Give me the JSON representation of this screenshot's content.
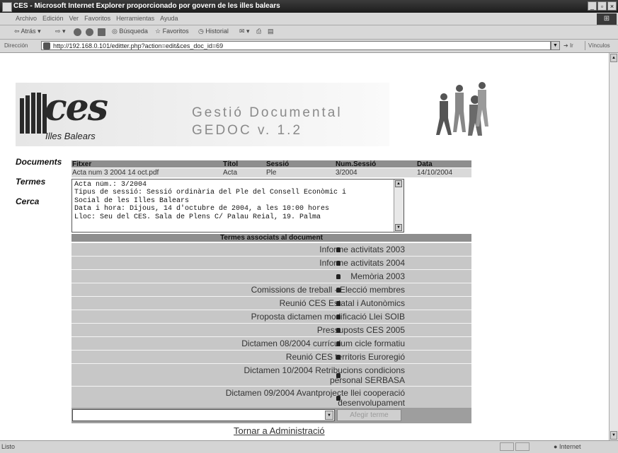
{
  "window": {
    "title": "CES - Microsoft Internet Explorer proporcionado por govern de les illes balears",
    "buttons": [
      "_",
      "▫",
      "×"
    ]
  },
  "menubar": {
    "items": [
      "Archivo",
      "Edición",
      "Ver",
      "Favoritos",
      "Herramientas",
      "Ayuda"
    ]
  },
  "toolbar": {
    "back_label": "Atrás",
    "search_label": "Búsqueda",
    "favorites_label": "Favoritos",
    "history_label": "Historial"
  },
  "addressbar": {
    "label": "Dirección",
    "url": "http://192.168.0.101/editter.php?action=edit&ces_doc_id=69",
    "go_label": "Ir",
    "links_label": "Vínculos"
  },
  "header": {
    "logo_text": "ces",
    "logo_subtitle": "Illes Balears",
    "app_title": "Gestió Documental",
    "app_version": "GEDOC v. 1.2"
  },
  "sidebar": {
    "items": [
      {
        "label": "Documents"
      },
      {
        "label": "Termes"
      },
      {
        "label": "Cerca"
      }
    ]
  },
  "document_table": {
    "columns": [
      "Fitxer",
      "Títol",
      "Sessió",
      "Num.Sessió",
      "Data"
    ],
    "row": [
      "Acta num 3 2004 14 oct.pdf",
      "Acta",
      "Ple",
      "3/2004",
      "14/10/2004"
    ]
  },
  "description": {
    "lines": [
      "Acta núm.: 3/2004",
      "Tipus de sessió: Sessió ordinària del Ple del Consell Econòmic i",
      "Social de les Illes Balears",
      "Data i hora: Dijous, 14 d'octubre de 2004, a les 10:00 hores",
      "Lloc: Seu del CES. Sala de Plens C/ Palau Reial, 19. Palma"
    ]
  },
  "terms": {
    "header": "Termes associats al document",
    "items": [
      {
        "label": "Informe activitats 2003"
      },
      {
        "label": "Informe activitats 2004"
      },
      {
        "label": "Memòria 2003"
      },
      {
        "label": "Comissions de treball - Elecció membres"
      },
      {
        "label": "Reunió CES Estatal i Autonòmics"
      },
      {
        "label": "Proposta dictamen modificació Llei SOIB"
      },
      {
        "label": "Pressuposts CES 2005"
      },
      {
        "label": "Dictamen 08/2004 currículum cicle formatiu"
      },
      {
        "label": "Reunió CES territoris Euroregió"
      },
      {
        "label": "Dictamen 10/2004 Retribucions condicions personal SERBASA"
      },
      {
        "label": "Dictamen 09/2004 Avantprojecte llei cooperació desenvolupament"
      }
    ]
  },
  "add_term": {
    "select_value": "",
    "button_label": "Afegir terme"
  },
  "back_link": "Tornar a Administració",
  "statusbar": {
    "left": "Listo",
    "right": "Internet"
  },
  "icons": {
    "delete_term": "trash-icon",
    "dropdown": "chevron-down-icon"
  }
}
